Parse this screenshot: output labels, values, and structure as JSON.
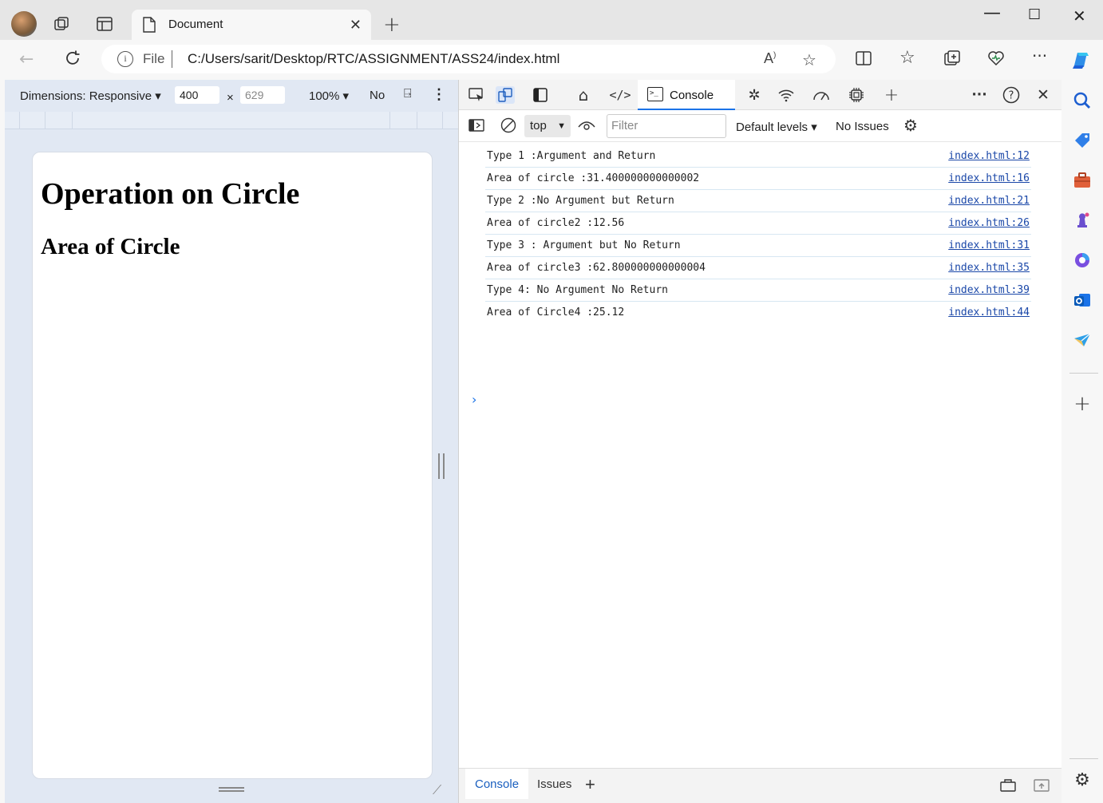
{
  "browser": {
    "tab_title": "Document",
    "address_scheme": "File",
    "url": "C:/Users/sarit/Desktop/RTC/ASSIGNMENT/ASS24/index.html"
  },
  "device_toolbar": {
    "dimensions_label": "Dimensions: Responsive",
    "width": "400",
    "times": "×",
    "height": "629",
    "zoom": "100%",
    "throttle": "No"
  },
  "page": {
    "heading": "Operation on Circle",
    "subheading": "Area of Circle"
  },
  "devtools": {
    "console_tab": "Console",
    "context": "top",
    "filter_placeholder": "Filter",
    "levels": "Default levels",
    "issues": "No Issues",
    "logs": [
      {
        "message": "Type 1 :Argument and Return",
        "source": "index.html:12"
      },
      {
        "message": "Area of circle :31.400000000000002",
        "source": "index.html:16"
      },
      {
        "message": "Type 2 :No Argument but Return",
        "source": "index.html:21"
      },
      {
        "message": "Area of circle2 :12.56",
        "source": "index.html:26"
      },
      {
        "message": "Type 3 : Argument but No Return",
        "source": "index.html:31"
      },
      {
        "message": "Area of circle3 :62.800000000000004",
        "source": "index.html:35"
      },
      {
        "message": "Type 4: No Argument No Return",
        "source": "index.html:39"
      },
      {
        "message": "Area of Circle4 :25.12",
        "source": "index.html:44"
      }
    ],
    "drawer_tabs": {
      "console": "Console",
      "issues": "Issues"
    }
  },
  "colors": {
    "accent": "#1a73e8",
    "link": "#1a47a8",
    "device_bg": "#e1e8f3"
  }
}
